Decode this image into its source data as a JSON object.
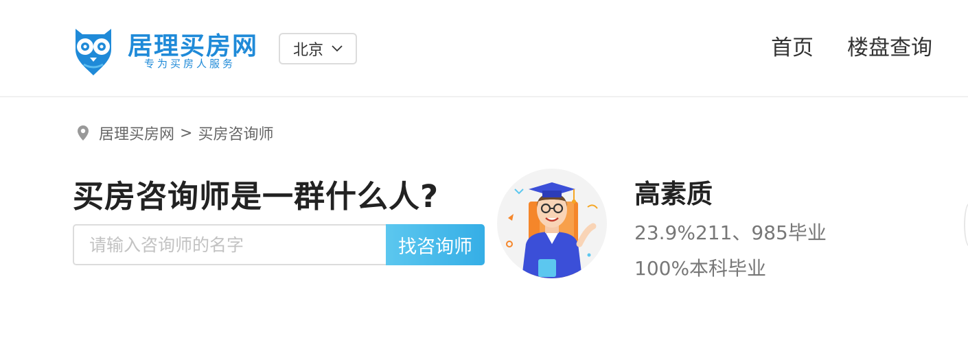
{
  "header": {
    "logo_title": "居理买房网",
    "logo_subtitle": "专为买房人服务",
    "city": "北京",
    "nav": {
      "home": "首页",
      "property_search": "楼盘查询"
    }
  },
  "breadcrumb": {
    "home": "居理买房网",
    "separator": ">",
    "current": "买房咨询师"
  },
  "hero": {
    "title": "买房咨询师是一群什么人?",
    "search_placeholder": "请输入咨询师的名字",
    "search_button": "找咨询师"
  },
  "feature": {
    "title": "高素质",
    "line1": "23.9%211、985毕业",
    "line2": "100%本科毕业"
  },
  "colors": {
    "brand": "#1f8ad8",
    "accent": "#35aee6"
  }
}
